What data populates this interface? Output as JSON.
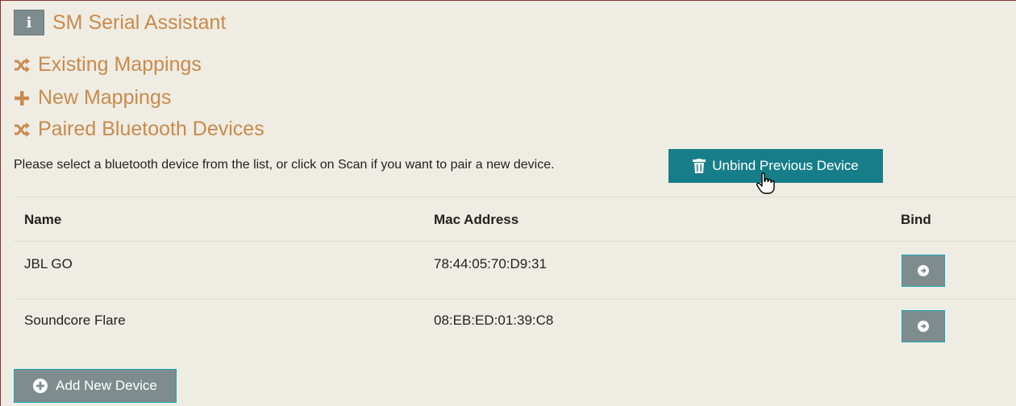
{
  "nav": {
    "title": "SM Serial Assistant",
    "info_glyph": "i",
    "existing_mappings": "Existing Mappings",
    "new_mappings": "New Mappings",
    "paired_devices": "Paired Bluetooth Devices"
  },
  "prompt": "Please select a bluetooth device from the list, or click on Scan if you want to pair a new device.",
  "unbind_button": "Unbind Previous Device",
  "table": {
    "headers": {
      "name": "Name",
      "mac": "Mac Address",
      "bind": "Bind"
    },
    "rows": [
      {
        "name": "JBL GO",
        "mac": "78:44:05:70:D9:31"
      },
      {
        "name": "Soundcore Flare",
        "mac": "08:EB:ED:01:39:C8"
      }
    ]
  },
  "add_button": "Add New Device",
  "colors": {
    "accent": "#c98a4d",
    "teal": "#177e89",
    "gray_button": "#7f8c8d",
    "background": "#efede3"
  },
  "icons": {
    "info": "info-icon",
    "shuffle": "shuffle-icon",
    "plus": "plus-icon",
    "trash": "trash-icon",
    "arrow": "arrow-right-circle-icon",
    "add": "plus-circle-icon",
    "cursor": "hand-cursor-icon"
  }
}
